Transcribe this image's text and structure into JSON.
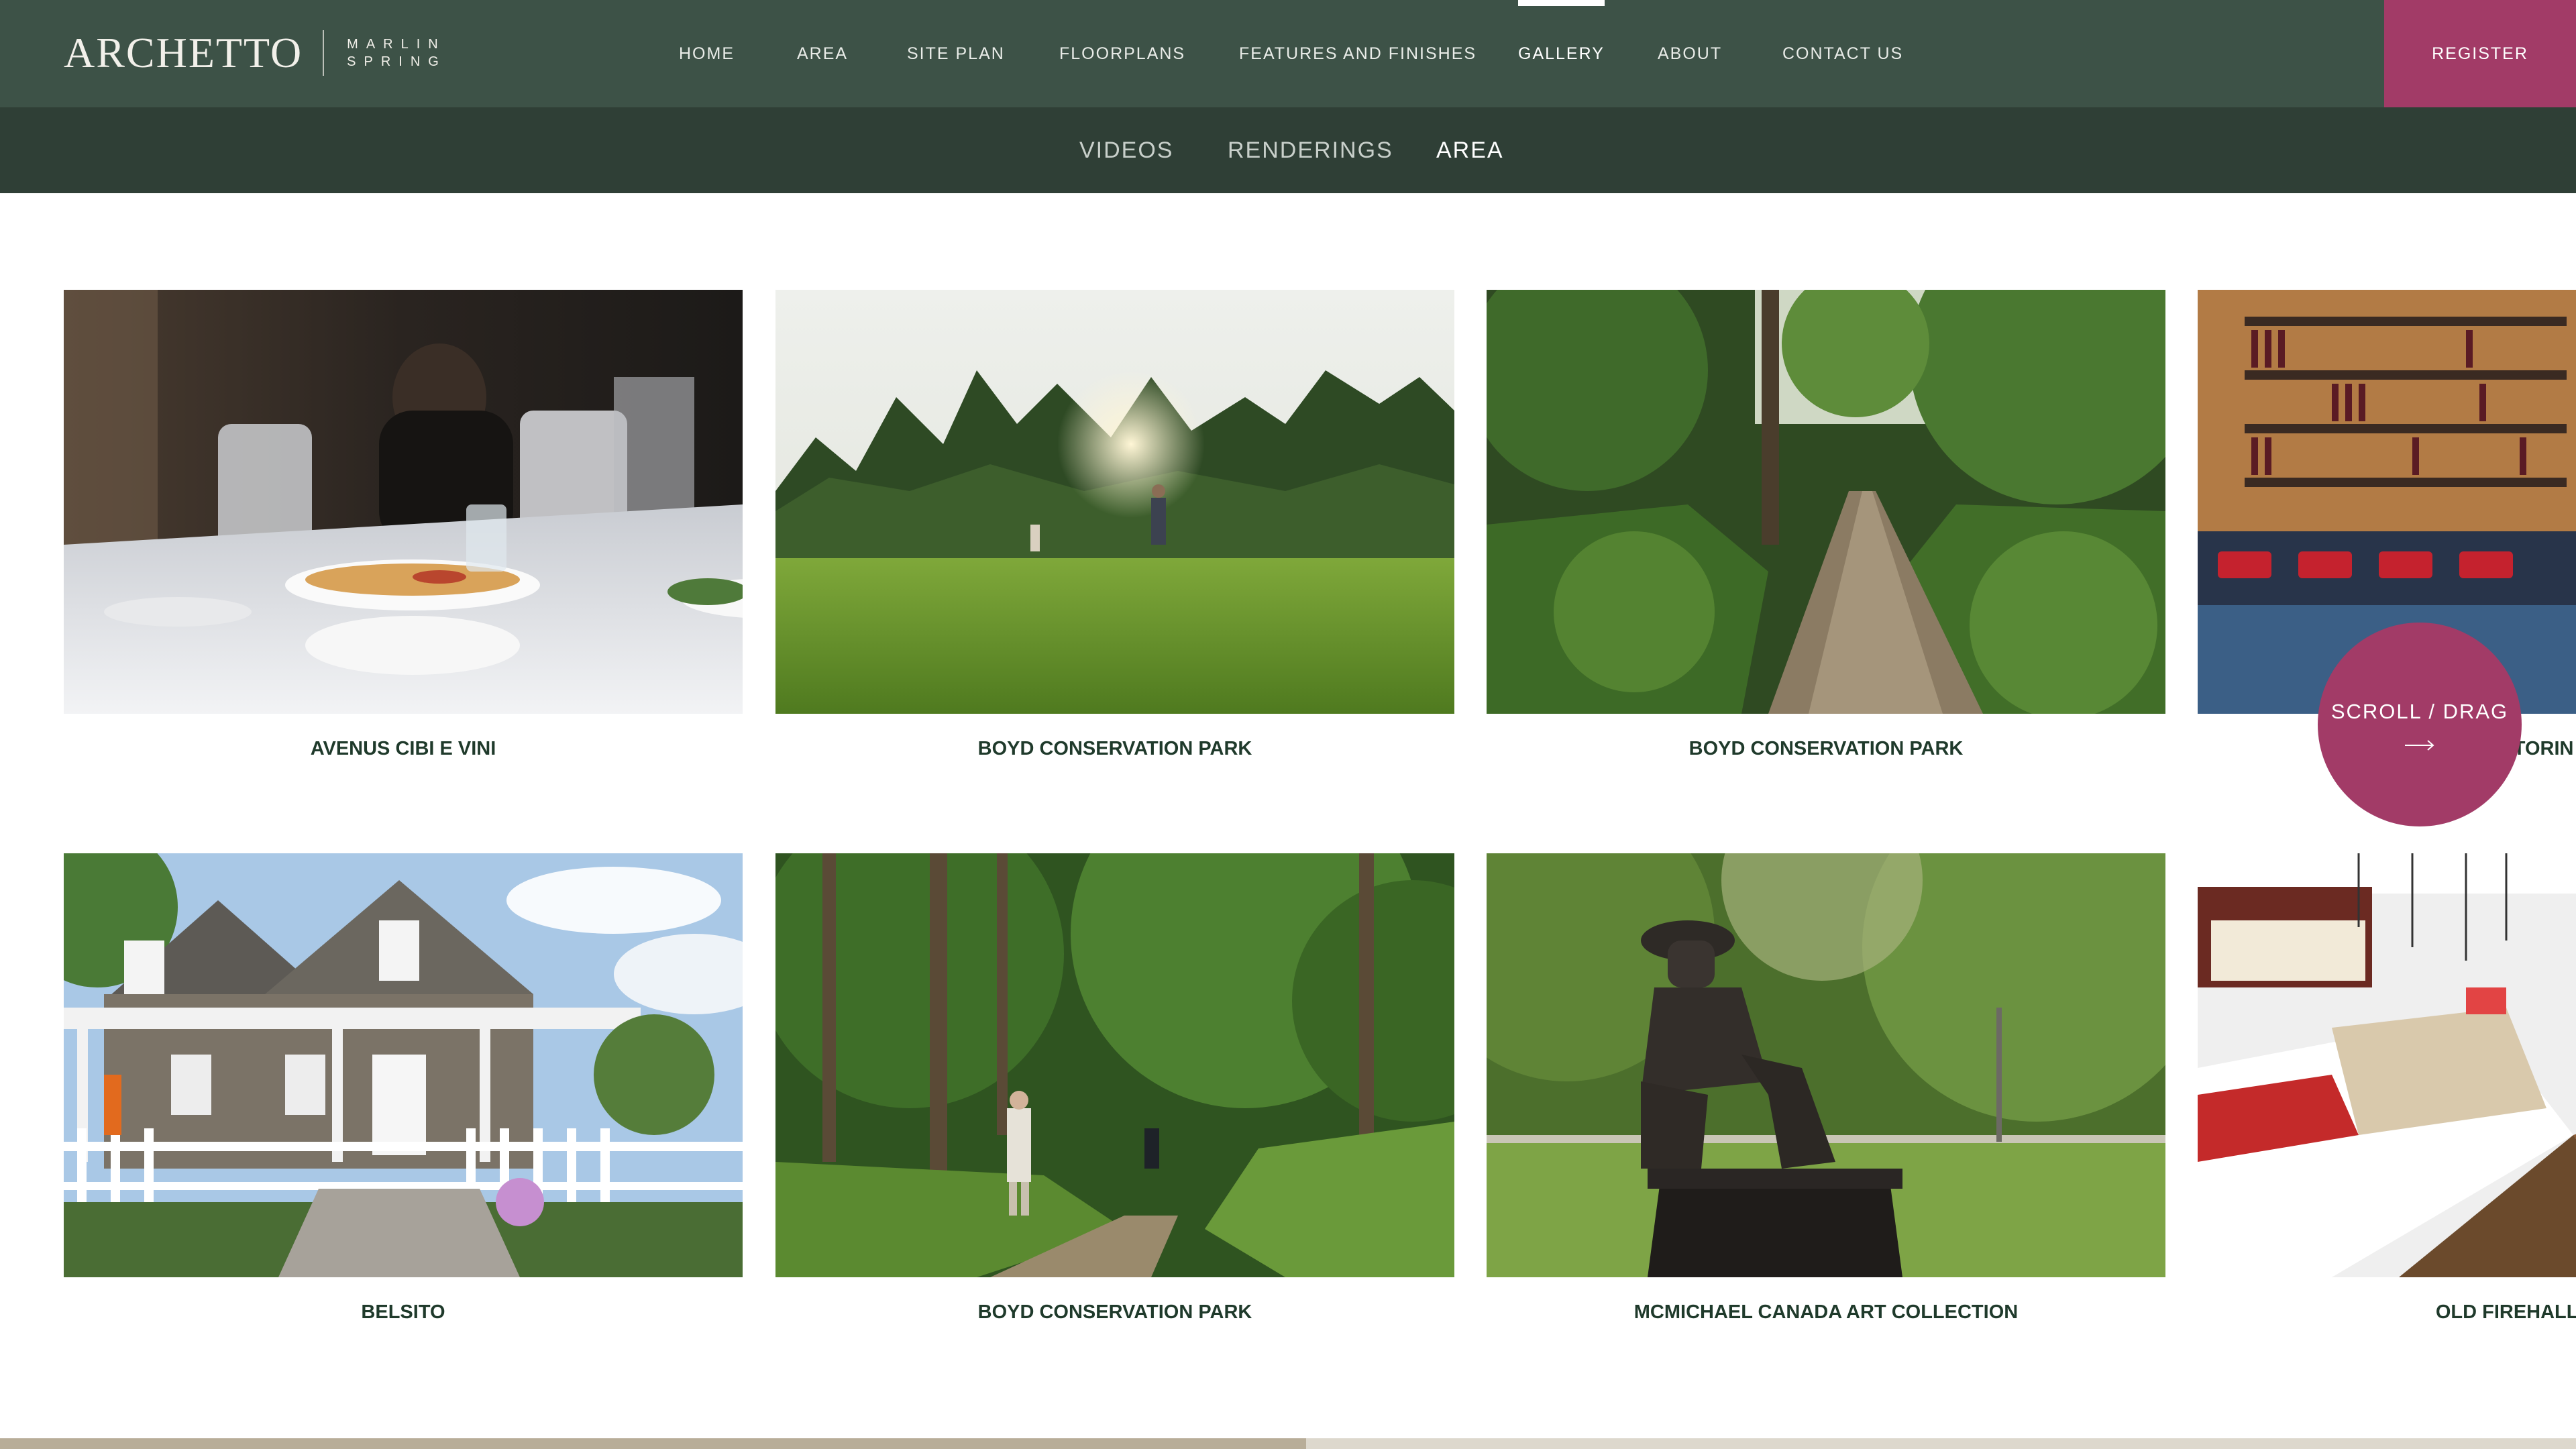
{
  "brand": {
    "logo_text": "ARCHETTO",
    "sub_line1": "MARLIN",
    "sub_line2": "SPRING"
  },
  "nav": {
    "items": [
      {
        "label": "HOME"
      },
      {
        "label": "AREA"
      },
      {
        "label": "SITE PLAN"
      },
      {
        "label": "FLOORPLANS"
      },
      {
        "label": "FEATURES AND FINISHES"
      },
      {
        "label": "GALLERY",
        "active": true
      },
      {
        "label": "ABOUT"
      },
      {
        "label": "CONTACT US"
      }
    ],
    "register_label": "REGISTER"
  },
  "subnav": {
    "items": [
      {
        "label": "VIDEOS"
      },
      {
        "label": "RENDERINGS"
      },
      {
        "label": "AREA",
        "active": true
      }
    ]
  },
  "gallery": {
    "items": [
      {
        "caption": "AVENUS CIBI E VINI"
      },
      {
        "caption": "BOYD CONSERVATION PARK"
      },
      {
        "caption": "BOYD CONSERVATION PARK"
      },
      {
        "caption": "STORIN"
      },
      {
        "caption": "BELSITO"
      },
      {
        "caption": "BOYD CONSERVATION PARK"
      },
      {
        "caption": "MCMICHAEL CANADA ART COLLECTION"
      },
      {
        "caption": "OLD FIREHALL CONF"
      }
    ]
  },
  "scroll_hint": {
    "label": "SCROLL / DRAG",
    "icon": "arrow-right-icon"
  },
  "progress": {
    "fraction": 0.507
  },
  "colors": {
    "nav_bg": "#3d5247",
    "subnav_bg": "#2f3f36",
    "accent": "#a23b67",
    "caption": "#1f3a2b"
  }
}
